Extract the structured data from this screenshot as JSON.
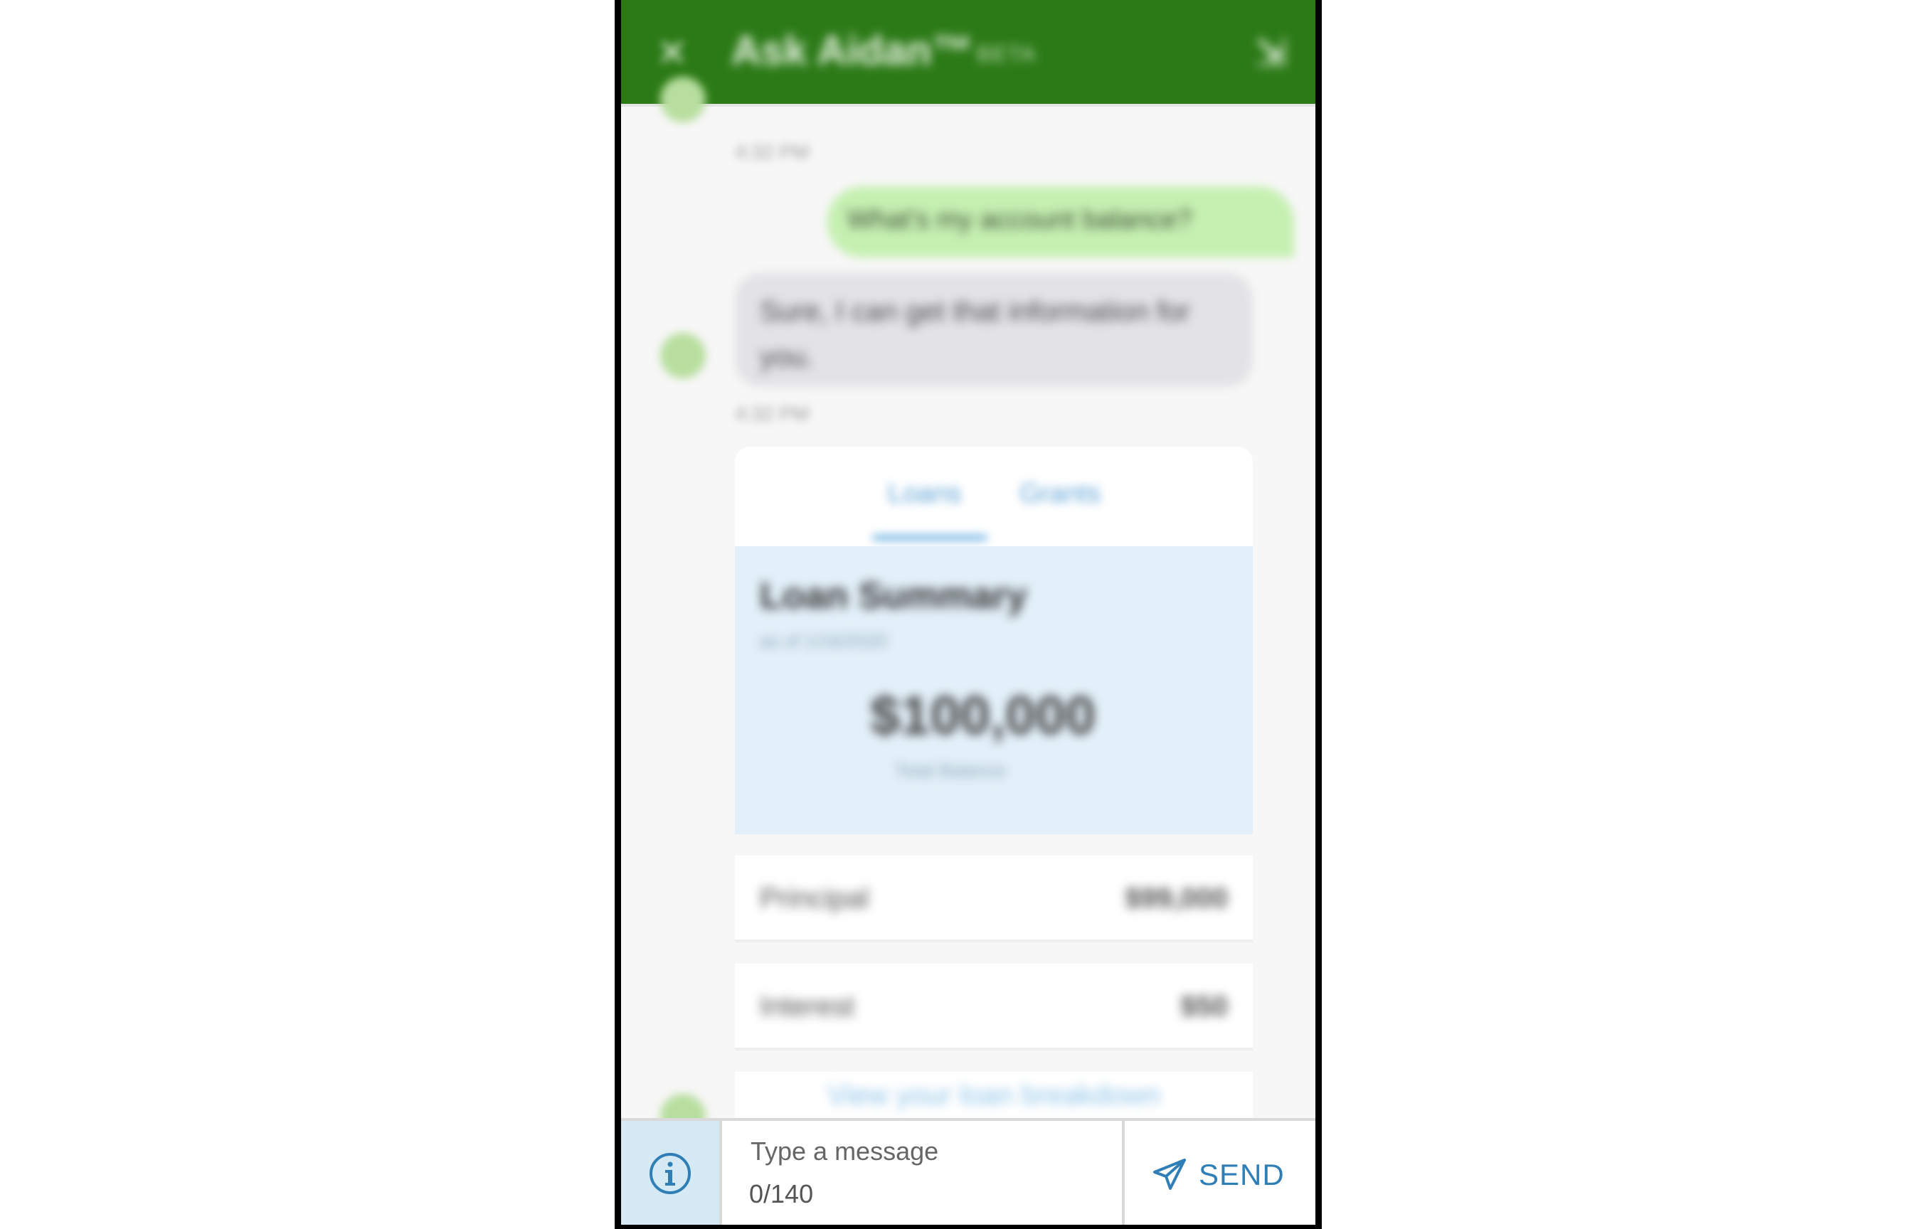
{
  "header": {
    "title": "Ask Aidan™",
    "beta": "BETA",
    "close_glyph": "✕",
    "right_glyph": "⇲"
  },
  "messages": {
    "first_time": "4:32 PM",
    "user_message": "What's my account balance?",
    "bot_message": "Sure, I can get that information for you.",
    "second_time": "4:32 PM"
  },
  "loan_card": {
    "tabs": [
      "Loans",
      "Grants"
    ],
    "summary_title": "Loan Summary",
    "summary_date": "as of 1/16/2020",
    "total_amount": "$100,000",
    "total_caption": "Total Balance",
    "rows": [
      {
        "label": "Principal",
        "value": "$99,000"
      },
      {
        "label": "Interest",
        "value": "$50"
      }
    ],
    "breakdown_link": "View your loan breakdown"
  },
  "composer": {
    "placeholder": "Type a message",
    "char_count": "0/140",
    "send_label": "SEND"
  },
  "icons": {
    "info": "info-icon",
    "send": "paper-plane-icon"
  },
  "colors": {
    "header_bg": "#2c7a17",
    "user_bubble": "#c6f0b2",
    "bot_bubble": "#e3e3e6",
    "accent_blue": "#2f7fb6",
    "info_bg": "#d6eaf5"
  }
}
